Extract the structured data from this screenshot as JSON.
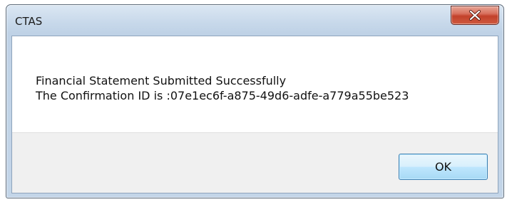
{
  "dialog": {
    "title": "CTAS",
    "close_icon": "close-icon",
    "message_line1": "Financial Statement Submitted Successfully",
    "message_line2": "The Confirmation ID is :07e1ec6f-a875-49d6-adfe-a779a55be523",
    "ok_label": "OK"
  },
  "colors": {
    "close_button": "#c2412b",
    "ok_button_border": "#3c7fb1",
    "footer_background": "#f0f0f0"
  }
}
